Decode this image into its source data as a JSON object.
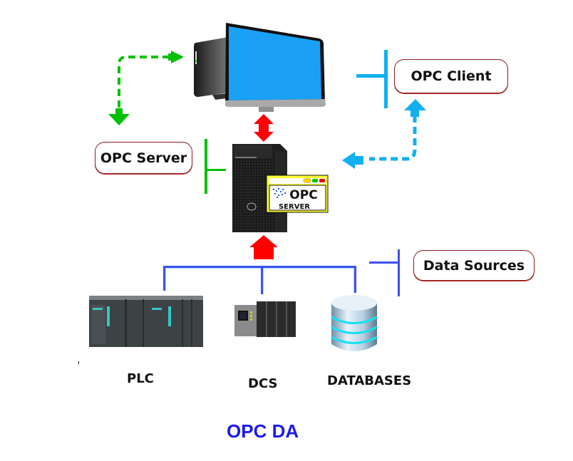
{
  "diagram": {
    "title": "OPC DA",
    "labels": {
      "opc_client": "OPC Client",
      "opc_server": "OPC Server",
      "data_sources": "Data Sources"
    },
    "devices": [
      {
        "id": "plc",
        "caption": "PLC"
      },
      {
        "id": "dcs",
        "caption": "DCS"
      },
      {
        "id": "databases",
        "caption": "DATABASES"
      }
    ],
    "server_badge": {
      "logo_text": "OPC",
      "sub_text": "SERVER"
    },
    "colors": {
      "client_accent": "#10b0f0",
      "server_accent": "#00c000",
      "data_accent": "#4050f0",
      "link_arrow": "#ff0000",
      "title": "#1a1aee",
      "label_border": "#8b1a1a",
      "monitor_screen": "#1aa0f5"
    },
    "connections": [
      {
        "from": "OPC Client",
        "to": "OPC Server",
        "style": "bidirectional",
        "color": "red"
      },
      {
        "from": "Data Sources",
        "to": "OPC Server",
        "style": "arrow-up",
        "color": "red"
      },
      {
        "from": "OPC Server",
        "to": "OPC Client",
        "style": "dashed",
        "color": "blue"
      },
      {
        "from": "OPC Client",
        "to": "OPC Server",
        "style": "dashed",
        "color": "green"
      }
    ]
  }
}
